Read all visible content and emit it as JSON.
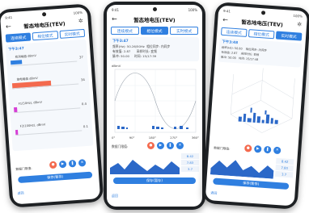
{
  "app_title": "暂态地电压(TEV)",
  "tabs": [
    "连续模式",
    "相位模式",
    "实时模式"
  ],
  "status": {
    "time": "9:41",
    "battery": "100%"
  },
  "icons": {
    "back": "back-arrow-icon",
    "settings": "gear-icon",
    "play": "play-icon",
    "pause": "pause-icon",
    "record": "record-icon",
    "delete": "delete-icon"
  },
  "colors": {
    "accent": "#2f7fe0",
    "bar_red": "#f46a4e",
    "bar_magenta": "#d63fd6",
    "waveform": "#2b68c8"
  },
  "phone1": {
    "time_label": "下午3:47",
    "levels": [
      {
        "label": "检测幅值 dBmV",
        "value": "37",
        "level": 0.15,
        "color": "#2f7fe0"
      },
      {
        "label": "放电幅值 dBmV",
        "value": "34",
        "level": 0.55,
        "color": "#f46a4e"
      },
      {
        "label": "F1(50Hz), dBmV",
        "value": "0.4",
        "level": 0.05,
        "color": "#d63fd6"
      },
      {
        "label": "F2(100Hz), dBmV",
        "value": "0.1",
        "level": 0.03,
        "color": "#d63fd6"
      }
    ],
    "threshold_label": "数据门限值:",
    "bottom_button": "保存(暂存)",
    "footer": "返回"
  },
  "phone2": {
    "time_label": "下午3:47",
    "info": [
      [
        "频率(Hz):",
        "50.26/50Hz",
        "相位同步:",
        "内同步"
      ],
      [
        "有效值:",
        "2.87",
        "采样时长:",
        "变频"
      ],
      [
        "脉冲:",
        "50.00",
        "时间:",
        "15/17:39"
      ]
    ],
    "y_unit": "dBmV",
    "x_ticks": [
      "0°",
      "90°",
      "180°",
      "270°",
      "360°"
    ],
    "threshold_label": "数据门限值:",
    "side_values": [
      "8.42",
      "7.83",
      "3.7"
    ],
    "bottom_button": "保存(暂存)",
    "footer": "返回"
  },
  "phone3": {
    "time_label": "下午3:48",
    "info": [
      [
        "频率(Hz):",
        "50.00",
        "相位同步:",
        "内同步"
      ],
      [
        "有效值:",
        "2.87",
        "采样时长:",
        "变频"
      ],
      [
        "脉冲:",
        "50.00",
        "时间:",
        "15/17:48"
      ]
    ],
    "threshold_label": "数据门限值:",
    "side_values": [
      "8.42",
      "7.83",
      "3.7"
    ],
    "bottom_button": "保存(暂存)",
    "footer": "返回"
  }
}
